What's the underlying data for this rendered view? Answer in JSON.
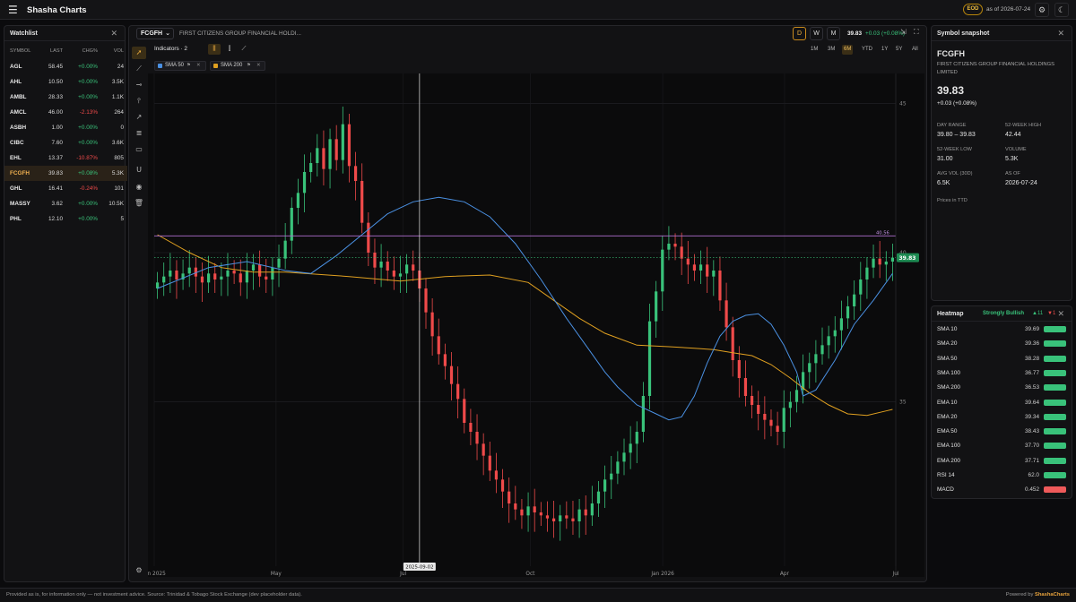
{
  "app": {
    "brand": "Shasha Charts",
    "eod_badge": "EOD",
    "as_of": "as of 2026-07-24"
  },
  "watchlist": {
    "title": "Watchlist",
    "columns": [
      "SYMBOL",
      "LAST",
      "CHG%",
      "VOL"
    ],
    "rows": [
      {
        "symbol": "AGL",
        "last": "58.45",
        "chg": "+0.00%",
        "vol": "24",
        "dir": "pos"
      },
      {
        "symbol": "AHL",
        "last": "10.50",
        "chg": "+0.00%",
        "vol": "3.5K",
        "dir": "pos"
      },
      {
        "symbol": "AMBL",
        "last": "28.33",
        "chg": "+0.00%",
        "vol": "1.1K",
        "dir": "pos"
      },
      {
        "symbol": "AMCL",
        "last": "46.00",
        "chg": "-2.13%",
        "vol": "264",
        "dir": "neg"
      },
      {
        "symbol": "ASBH",
        "last": "1.00",
        "chg": "+0.00%",
        "vol": "0",
        "dir": "pos"
      },
      {
        "symbol": "CIBC",
        "last": "7.60",
        "chg": "+0.00%",
        "vol": "3.6K",
        "dir": "pos"
      },
      {
        "symbol": "EHL",
        "last": "13.37",
        "chg": "-10.87%",
        "vol": "805",
        "dir": "neg"
      },
      {
        "symbol": "FCGFH",
        "last": "39.83",
        "chg": "+0.08%",
        "vol": "5.3K",
        "dir": "pos",
        "selected": true
      },
      {
        "symbol": "GHL",
        "last": "16.41",
        "chg": "-0.24%",
        "vol": "101",
        "dir": "neg"
      },
      {
        "symbol": "MASSY",
        "last": "3.62",
        "chg": "+0.00%",
        "vol": "10.5K",
        "dir": "pos"
      },
      {
        "symbol": "PHL",
        "last": "12.10",
        "chg": "+0.00%",
        "vol": "5",
        "dir": "pos"
      }
    ]
  },
  "chart_header": {
    "ticker": "FCGFH",
    "company": "FIRST CITIZENS GROUP FINANCIAL HOLDI...",
    "intervals": [
      "D",
      "W",
      "M"
    ],
    "active_interval": "D",
    "last_price": "39.83",
    "change": "+0.03 (+0.08%)",
    "indicators_label": "Indicators · 2",
    "ranges": [
      "1M",
      "3M",
      "6M",
      "YTD",
      "1Y",
      "5Y",
      "All"
    ],
    "active_range": "6M",
    "chips": [
      {
        "label": "SMA 50",
        "color": "#4a90e2"
      },
      {
        "label": "SMA 200",
        "color": "#e0a020"
      }
    ]
  },
  "chart_data": {
    "type": "candlestick",
    "y_ticks": [
      "45",
      "40",
      "35"
    ],
    "x_ticks": [
      "Jan 2025",
      "May",
      "Jul",
      "Oct",
      "Jan 2026",
      "Apr",
      "Jul"
    ],
    "crosshair_date": "2025-09-02",
    "hline_value": "40.56",
    "last_label": "39.83",
    "ylim": [
      29.5,
      46
    ],
    "sma50_color": "#4a90e2",
    "sma200_color": "#e0a020",
    "up_color": "#39c27a",
    "down_color": "#ef4a4a",
    "sma50": [
      [
        0,
        38.8
      ],
      [
        8,
        39.5
      ],
      [
        14,
        39.7
      ],
      [
        20,
        39.4
      ],
      [
        24,
        39.3
      ],
      [
        28,
        39.9
      ],
      [
        32,
        40.6
      ],
      [
        36,
        41.3
      ],
      [
        40,
        41.7
      ],
      [
        44,
        41.85
      ],
      [
        48,
        41.7
      ],
      [
        52,
        41.2
      ],
      [
        56,
        40.3
      ],
      [
        60,
        39.1
      ],
      [
        64,
        37.8
      ],
      [
        68,
        36.6
      ],
      [
        70,
        36.0
      ],
      [
        72,
        35.5
      ],
      [
        75,
        34.9
      ],
      [
        78,
        34.6
      ],
      [
        80,
        34.4
      ],
      [
        82,
        34.5
      ],
      [
        84,
        35.2
      ],
      [
        86,
        36.3
      ],
      [
        88,
        37.2
      ],
      [
        90,
        37.7
      ],
      [
        92,
        37.9
      ],
      [
        94,
        37.95
      ],
      [
        96,
        37.6
      ],
      [
        98,
        36.9
      ],
      [
        100,
        36.0
      ],
      [
        101,
        35.2
      ],
      [
        103,
        35.4
      ],
      [
        106,
        36.4
      ],
      [
        109,
        37.6
      ],
      [
        112,
        38.4
      ],
      [
        115,
        39.3
      ]
    ],
    "sma200": [
      [
        0,
        40.6
      ],
      [
        5,
        40.0
      ],
      [
        10,
        39.5
      ],
      [
        15,
        39.35
      ],
      [
        20,
        39.35
      ],
      [
        30,
        39.2
      ],
      [
        38,
        39.05
      ],
      [
        45,
        39.2
      ],
      [
        52,
        39.25
      ],
      [
        58,
        39.0
      ],
      [
        62,
        38.4
      ],
      [
        66,
        37.8
      ],
      [
        70,
        37.3
      ],
      [
        75,
        36.9
      ],
      [
        80,
        36.85
      ],
      [
        84,
        36.8
      ],
      [
        87,
        36.75
      ],
      [
        90,
        36.65
      ],
      [
        93,
        36.55
      ],
      [
        96,
        36.25
      ],
      [
        99,
        35.8
      ],
      [
        102,
        35.3
      ],
      [
        105,
        34.9
      ],
      [
        108,
        34.6
      ],
      [
        111,
        34.55
      ],
      [
        114,
        34.7
      ],
      [
        115,
        34.75
      ]
    ],
    "close": [
      39.0,
      39.2,
      39.4,
      39.1,
      39.3,
      39.5,
      39.2,
      39.0,
      39.3,
      39.1,
      39.2,
      39.4,
      39.3,
      39.0,
      39.4,
      39.6,
      39.2,
      39.1,
      39.5,
      39.8,
      40.4,
      41.5,
      42.0,
      42.7,
      43.0,
      43.5,
      42.8,
      43.8,
      43.1,
      44.3,
      42.9,
      42.4,
      41.0,
      40.0,
      39.5,
      39.7,
      39.4,
      39.2,
      39.3,
      39.6,
      39.4,
      38.8,
      38.0,
      37.2,
      36.6,
      36.2,
      35.6,
      35.1,
      34.3,
      34.0,
      33.6,
      33.2,
      32.7,
      32.4,
      32.0,
      31.6,
      31.4,
      31.2,
      31.5,
      31.3,
      31.2,
      31.1,
      31.0,
      31.2,
      31.1,
      31.0,
      31.4,
      31.2,
      31.6,
      32.0,
      32.4,
      32.6,
      33.0,
      33.3,
      33.6,
      34.0,
      35.2,
      37.7,
      38.7,
      40.1,
      40.3,
      40.2,
      39.8,
      39.6,
      39.4,
      39.6,
      39.2,
      39.4,
      38.4,
      37.5,
      36.4,
      35.8,
      35.2,
      34.9,
      34.6,
      34.4,
      34.2,
      34.0,
      34.8,
      35.0,
      35.4,
      36.0,
      36.3,
      36.6,
      36.9,
      37.2,
      37.4,
      37.8,
      38.2,
      38.6,
      39.1,
      39.5,
      39.8,
      39.6,
      39.7,
      39.83
    ]
  },
  "snapshot": {
    "title": "Symbol snapshot",
    "ticker": "FCGFH",
    "name": "FIRST CITIZENS GROUP FINANCIAL HOLDINGS LIMITED",
    "price": "39.83",
    "change": "+0.03 (+0.08%)",
    "day_range_label": "DAY RANGE",
    "day_range": "39.80 – 39.83",
    "high52_label": "52-WEEK HIGH",
    "high52": "42.44",
    "low52_label": "52-WEEK LOW",
    "low52": "31.00",
    "volume_label": "VOLUME",
    "volume": "5.3K",
    "avgvol_label": "AVG VOL (30D)",
    "avgvol": "6.5K",
    "asof_label": "AS OF",
    "asof": "2026-07-24",
    "note": "Prices in TTD"
  },
  "heatmap": {
    "title": "Heatmap",
    "status": "Strongly Bullish",
    "up_count": "▲11",
    "down_count": "▼1",
    "rows": [
      {
        "name": "SMA 10",
        "value": "39.69",
        "dir": "up"
      },
      {
        "name": "SMA 20",
        "value": "39.36",
        "dir": "up"
      },
      {
        "name": "SMA 50",
        "value": "38.28",
        "dir": "up"
      },
      {
        "name": "SMA 100",
        "value": "36.77",
        "dir": "up"
      },
      {
        "name": "SMA 200",
        "value": "36.53",
        "dir": "up"
      },
      {
        "name": "EMA 10",
        "value": "39.64",
        "dir": "up"
      },
      {
        "name": "EMA 20",
        "value": "39.34",
        "dir": "up"
      },
      {
        "name": "EMA 50",
        "value": "38.43",
        "dir": "up"
      },
      {
        "name": "EMA 100",
        "value": "37.70",
        "dir": "up"
      },
      {
        "name": "EMA 200",
        "value": "37.71",
        "dir": "up"
      },
      {
        "name": "RSI 14",
        "value": "62.0",
        "dir": "up"
      },
      {
        "name": "MACD",
        "value": "0.452",
        "dir": "down"
      }
    ]
  },
  "footer": {
    "left": "Provided as is, for information only — not investment advice. Source: Trinidad & Tobago Stock Exchange (dev placeholder data).",
    "right_prefix": "Powered by ",
    "right_brand": "ShashaCharts"
  }
}
